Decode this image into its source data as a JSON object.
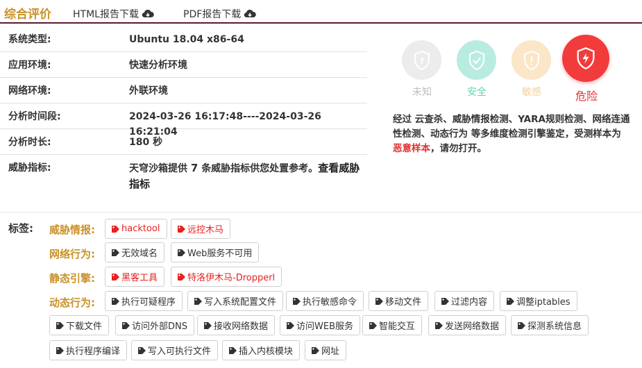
{
  "header": {
    "title": "综合评价",
    "html_report": "HTML报告下载",
    "pdf_report": "PDF报告下载"
  },
  "info": {
    "rows": [
      {
        "label": "系统类型:",
        "value": "Ubuntu 18.04 x86-64"
      },
      {
        "label": "应用环境:",
        "value": "快速分析环境"
      },
      {
        "label": "网络环境:",
        "value": "外联环境"
      },
      {
        "label": "分析时间段:",
        "value": "2024-03-26 16:17:48----2024-03-26 16:21:04"
      },
      {
        "label": "分析时长:",
        "value": "180 秒"
      }
    ],
    "threat_label": "威胁指标:",
    "threat_prefix": "天穹沙箱提供",
    "threat_count": "7",
    "threat_suffix": "条威胁指标供您处置参考。",
    "threat_link_1": "查看威胁",
    "threat_link_2": "指标"
  },
  "risk": {
    "unknown": "未知",
    "safe": "安全",
    "sensitive": "敏感",
    "danger": "危险"
  },
  "verdict": {
    "text": "经过 云查杀、威胁情报检测、YARA规则检测、网络连通性检测、动态行为 等多维度检测引擎鉴定，受测样本为",
    "malicious": "恶意样本",
    "suffix": "，请勿打开。"
  },
  "tags": {
    "title": "标签:",
    "categories": {
      "threat_intel": "威胁情报:",
      "network": "网络行为:",
      "static": "静态引擎:",
      "dynamic": "动态行为:"
    },
    "threat_intel": [
      "hacktool",
      "远控木马"
    ],
    "network": [
      "无效域名",
      "Web服务不可用"
    ],
    "static": [
      "黑客工具",
      "特洛伊木马-Dropperl"
    ],
    "dynamic": [
      "执行可疑程序",
      "写入系统配置文件",
      "执行敏感命令",
      "移动文件",
      "过滤内容",
      "调整iptables",
      "下载文件",
      "访问外部DNS",
      "接收网络数据",
      "访问WEB服务",
      "智能交互",
      "发送网络数据",
      "探测系统信息",
      "执行程序编译",
      "写入可执行文件",
      "插入内核模块",
      "网址"
    ]
  },
  "colors": {
    "accent": "#c9912a",
    "danger": "#e23030",
    "header_line": "#5a1a35"
  }
}
